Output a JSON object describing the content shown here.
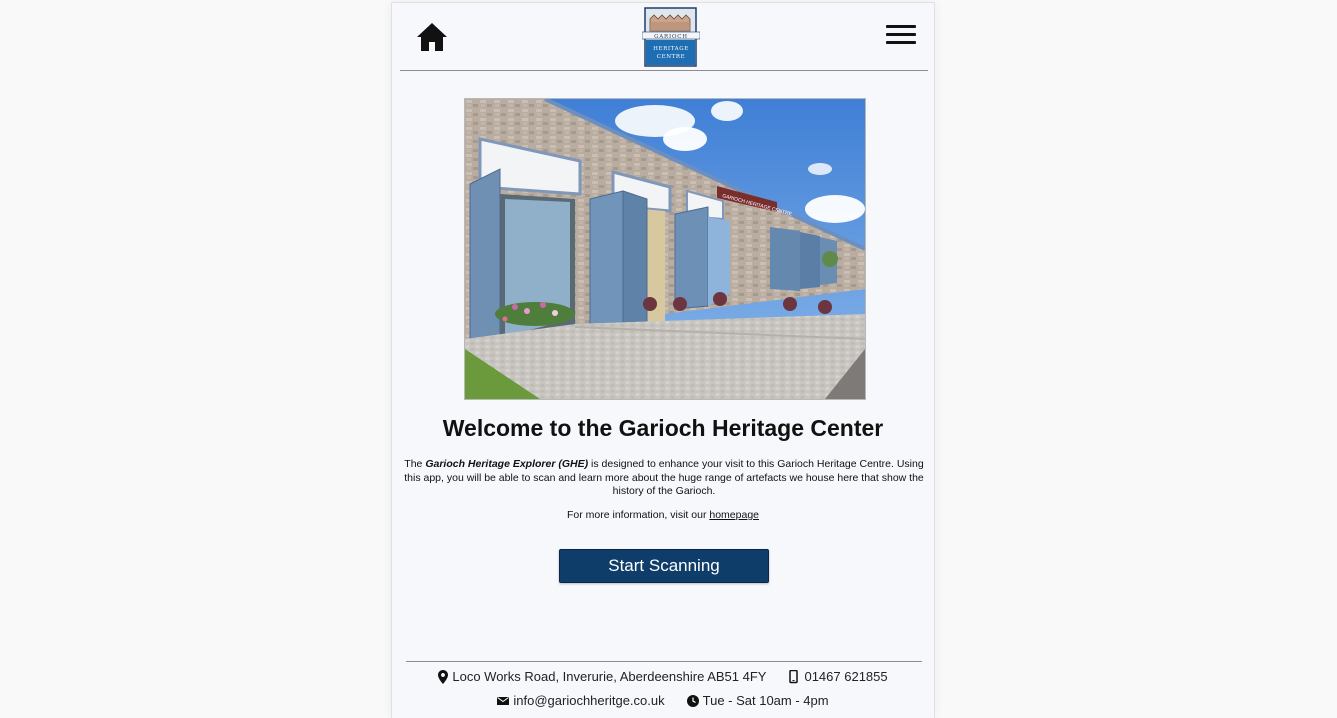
{
  "header": {
    "home_icon": "home-icon",
    "menu_icon": "hamburger-menu-icon",
    "logo": {
      "line1": "GARIOCH",
      "line2": "HERITAGE",
      "line3": "CENTRE"
    }
  },
  "hero": {
    "sign_text": "GARIOCH HERITAGE CENTRE"
  },
  "main": {
    "title": "Welcome to the Garioch Heritage Center",
    "intro_before": "The ",
    "intro_app_name": "Garioch Heritage Explorer (GHE)",
    "intro_after": " is designed to enhance your visit to this Garioch Heritage Centre. Using this app, you will be able to scan and learn more about the huge range of artefacts we house here that show the history of the Garioch.",
    "more_info_text": "For more information, visit our ",
    "homepage_link": "homepage",
    "scan_button": "Start Scanning"
  },
  "footer": {
    "address": "Loco Works Road, Inverurie, Aberdeenshire AB51 4FY",
    "phone": "01467 621855",
    "email": "info@gariochheritge.co.uk",
    "hours": "Tue - Sat 10am - 4pm"
  },
  "colors": {
    "accent": "#0e3d6a",
    "background": "#f7f8fc",
    "page": "#f9f9f9"
  }
}
